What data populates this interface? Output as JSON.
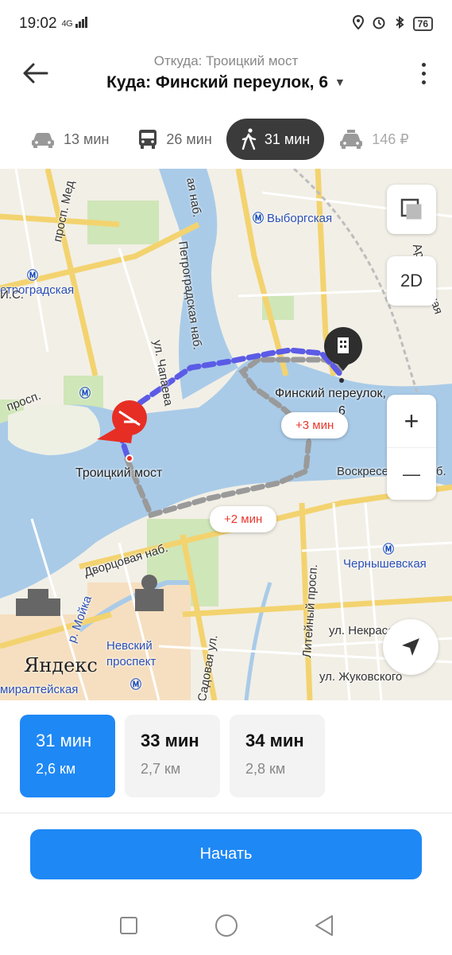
{
  "status_bar": {
    "time": "19:02",
    "network": "4G",
    "battery": "76"
  },
  "header": {
    "from": "Откуда: Троицкий мост",
    "to": "Куда: Финский переулок, 6"
  },
  "transport_tabs": [
    {
      "mode": "car",
      "label": "13 мин",
      "active": false
    },
    {
      "mode": "bus",
      "label": "26 мин",
      "active": false
    },
    {
      "mode": "walk",
      "label": "31 мин",
      "active": true
    },
    {
      "mode": "taxi",
      "label": "146 ₽",
      "active": false
    }
  ],
  "map": {
    "labels": {
      "vyborgskaya": "Выборгская",
      "petrogradskaya": "етроградская",
      "chernyshevskaya": "Чернышевская",
      "admiralteyskaya": "миралтейская",
      "nevsky": "Невский\nпроспект",
      "troitsky": "Троицкий мост",
      "finsky": "Финский переулок,",
      "finsky_num": "6",
      "dvortsovaya": "Дворцовая наб.",
      "voskresenskaya": "Воскресенская наб.",
      "liteyny": "Литейный просп.",
      "sadovaya": "Садовая ул.",
      "nekrasova": "ул. Некрасова",
      "zhukovskogo": "ул. Жуковского",
      "chapaeva": "ул. Чапаева",
      "petrogradskaya_nab": "Петроградская наб.",
      "moyka": "р. Мойка",
      "prosp_med": "просп. Мед",
      "prosp_left": "просп.",
      "arsenalnaya": "Арсенальная",
      "naberezhnaya_top": "ая наб.",
      "is": "И.С."
    },
    "yandex": "Яндекс",
    "mode_button": "2D",
    "zoom_in": "+",
    "zoom_out": "—",
    "bubble_1": "+3 мин",
    "bubble_2": "+2 мин"
  },
  "routes": [
    {
      "time": "31 мин",
      "distance": "2,6 км",
      "active": true
    },
    {
      "time": "33 мин",
      "distance": "2,7 км",
      "active": false
    },
    {
      "time": "34 мин",
      "distance": "2,8 км",
      "active": false
    }
  ],
  "start_button": "Начать"
}
